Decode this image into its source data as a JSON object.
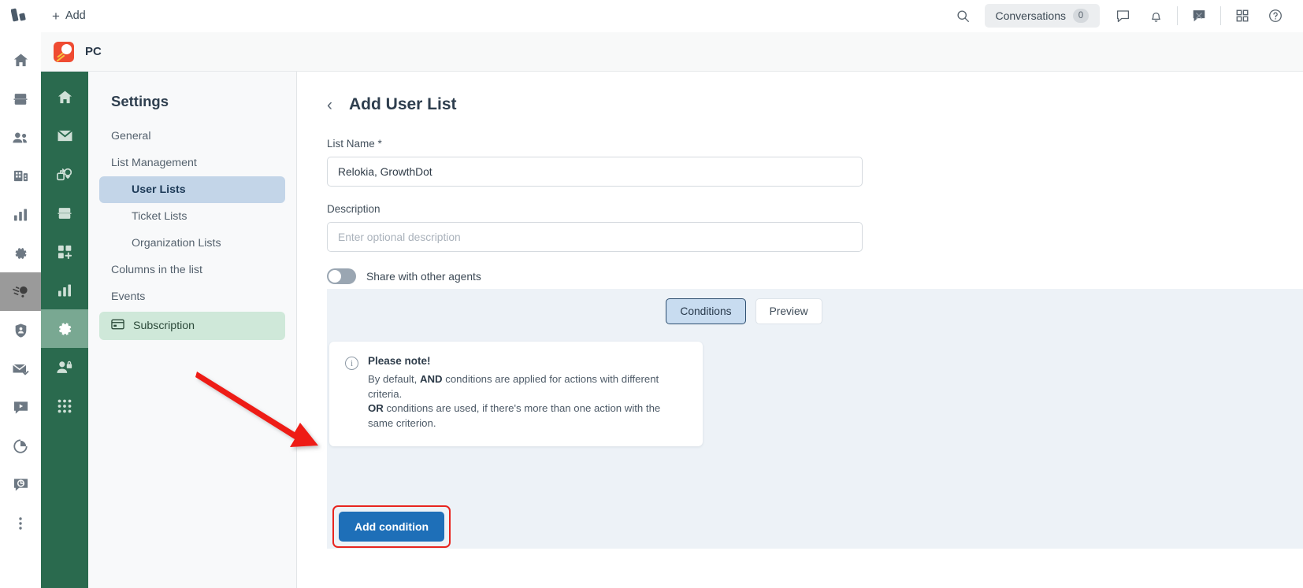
{
  "topbar": {
    "add_label": "Add",
    "add_icon": "plus-icon",
    "logo_icon": "app-logo-icon",
    "search_icon": "search-icon",
    "conversations_label": "Conversations",
    "conversations_count": "0",
    "chat_icon": "chat-bubble-icon",
    "bell_icon": "bell-icon",
    "messenger_icon": "messenger-icon",
    "apps_icon": "grid-apps-icon",
    "help_icon": "help-circle-icon"
  },
  "rail": {
    "items": [
      {
        "name": "home",
        "icon": "home-icon"
      },
      {
        "name": "tickets",
        "icon": "inbox-stack-icon"
      },
      {
        "name": "customers",
        "icon": "people-icon"
      },
      {
        "name": "organizations",
        "icon": "building-icon"
      },
      {
        "name": "reports",
        "icon": "bar-chart-icon"
      },
      {
        "name": "settings",
        "icon": "gear-icon"
      },
      {
        "name": "comet",
        "icon": "comet-icon"
      },
      {
        "name": "security",
        "icon": "shield-user-icon"
      },
      {
        "name": "mail",
        "icon": "mail-check-icon"
      },
      {
        "name": "video",
        "icon": "video-play-icon"
      },
      {
        "name": "analytics",
        "icon": "pie-chart-icon"
      },
      {
        "name": "feedback",
        "icon": "chat-refresh-icon"
      },
      {
        "name": "more",
        "icon": "more-vertical-icon"
      }
    ]
  },
  "greenbar": {
    "items": [
      {
        "name": "home",
        "icon": "home-icon",
        "active": false
      },
      {
        "name": "mail",
        "icon": "envelope-icon",
        "active": false
      },
      {
        "name": "automation",
        "icon": "flow-loop-icon",
        "active": false
      },
      {
        "name": "lists",
        "icon": "inbox-stack-icon",
        "active": false
      },
      {
        "name": "apps-add",
        "icon": "grid-plus-icon",
        "active": false
      },
      {
        "name": "reports",
        "icon": "bar-chart-icon",
        "active": false
      },
      {
        "name": "settings",
        "icon": "gear-icon",
        "active": true
      },
      {
        "name": "permissions",
        "icon": "user-lock-icon",
        "active": false
      },
      {
        "name": "apps",
        "icon": "dots-grid-icon",
        "active": false
      }
    ]
  },
  "workspace": {
    "name": "PC",
    "logo_icon": "pc-workspace-logo"
  },
  "settings": {
    "title": "Settings",
    "items": [
      {
        "label": "General",
        "level": "top",
        "state": "normal"
      },
      {
        "label": "List Management",
        "level": "top",
        "state": "normal"
      },
      {
        "label": "User Lists",
        "level": "sub",
        "state": "selected"
      },
      {
        "label": "Ticket Lists",
        "level": "sub",
        "state": "normal"
      },
      {
        "label": "Organization Lists",
        "level": "sub",
        "state": "normal"
      },
      {
        "label": "Columns in the list",
        "level": "top",
        "state": "normal"
      },
      {
        "label": "Events",
        "level": "top",
        "state": "normal"
      }
    ],
    "subscription": {
      "label": "Subscription",
      "icon": "credit-card-icon"
    }
  },
  "main": {
    "back_icon": "chevron-left-icon",
    "title": "Add User List",
    "list_name_label": "List Name *",
    "list_name_value": "Relokia, GrowthDot",
    "description_label": "Description",
    "description_value": "",
    "description_placeholder": "Enter optional description",
    "share_toggle_label": "Share with other agents",
    "share_toggle_state": "off",
    "tabs": [
      {
        "label": "Conditions",
        "active": true
      },
      {
        "label": "Preview",
        "active": false
      }
    ],
    "note": {
      "icon": "info-icon",
      "title": "Please note!",
      "line1_pre": "By default, ",
      "line1_bold": "AND",
      "line1_post": " conditions are applied for actions with different criteria.",
      "line2_bold": "OR",
      "line2_post": " conditions are used, if there's more than one action with the same criterion."
    },
    "add_condition_label": "Add condition"
  },
  "annotation": {
    "arrow_color": "#ee1c16",
    "highlight_color": "#e8251f"
  }
}
